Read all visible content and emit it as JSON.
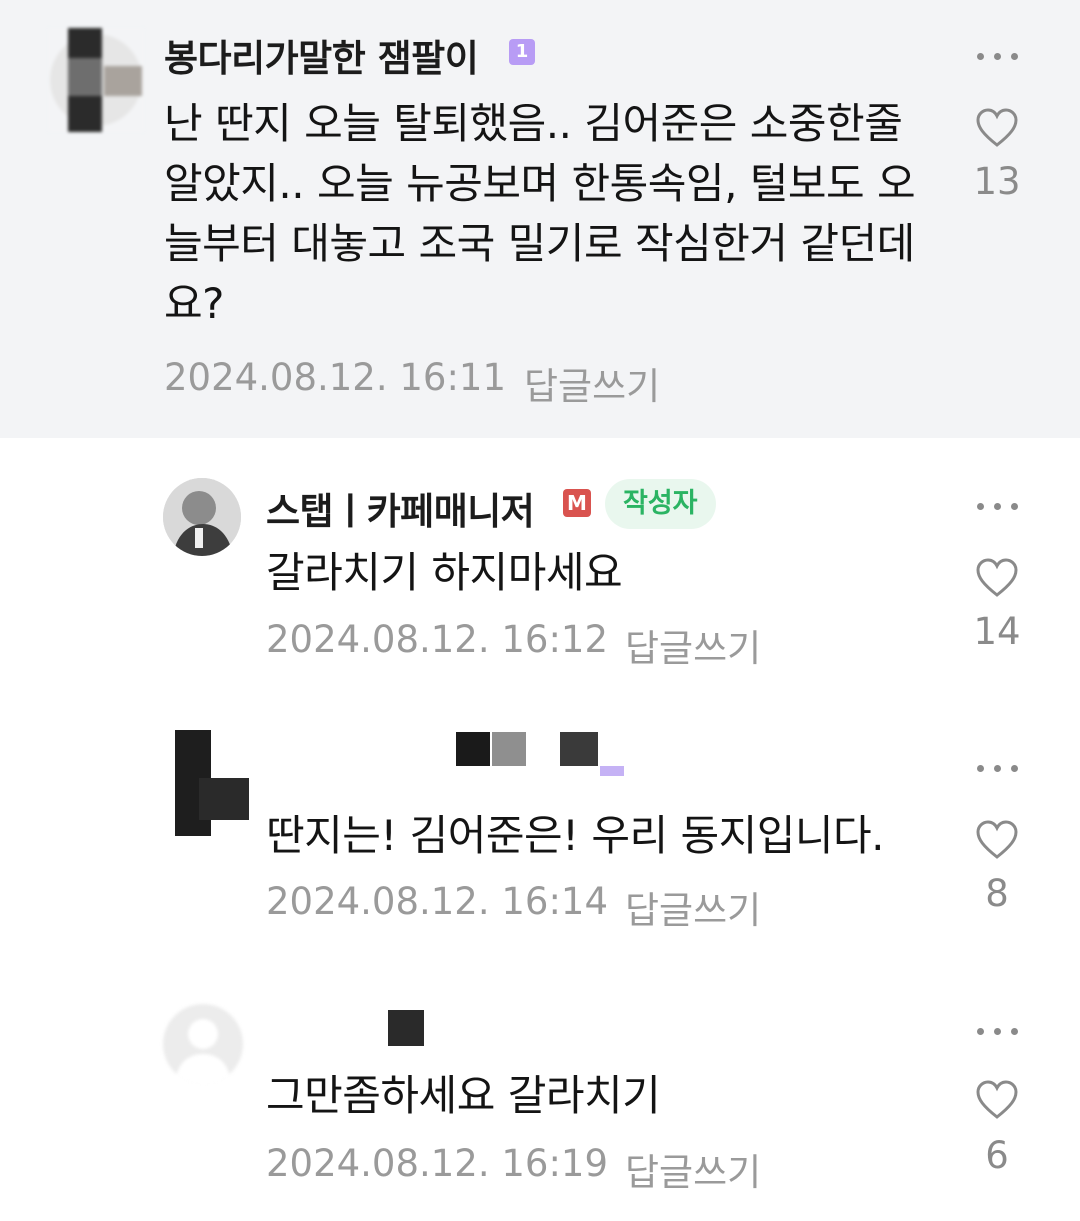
{
  "comments": [
    {
      "author": "봉다리가말한 잼팔이",
      "level_badge": "1",
      "text": "난 딴지 오늘 탈퇴했음.. 김어준은 소중한줄 알았지.. 오늘 뉴공보며 한통속임, 털보도 오늘부터 대놓고 조국 밀기로 작심한거 같던데요?",
      "date": "2024.08.12. 16:11",
      "reply_label": "답글쓰기",
      "likes": "13"
    },
    {
      "author": "스탭ㅣ카페매니저",
      "manager_badge": "M",
      "author_badge": "작성자",
      "text": "갈라치기 하지마세요",
      "date": "2024.08.12. 16:12",
      "reply_label": "답글쓰기",
      "likes": "14"
    },
    {
      "author": "",
      "text": "딴지는! 김어준은! 우리 동지입니다.",
      "date": "2024.08.12. 16:14",
      "reply_label": "답글쓰기",
      "likes": "8"
    },
    {
      "author": "",
      "text": "그만좀하세요 갈라치기",
      "date": "2024.08.12. 16:19",
      "reply_label": "답글쓰기",
      "likes": "6"
    }
  ],
  "colors": {
    "highlight_bg": "#f3f4f6",
    "meta_gray": "#9a9a9a",
    "author_badge_green": "#2bb463",
    "level_badge_purple": "#b89cf5",
    "manager_badge_red": "#d9534f"
  },
  "icons": [
    "more-icon",
    "heart-icon",
    "level-badge",
    "manager-badge",
    "avatar"
  ]
}
